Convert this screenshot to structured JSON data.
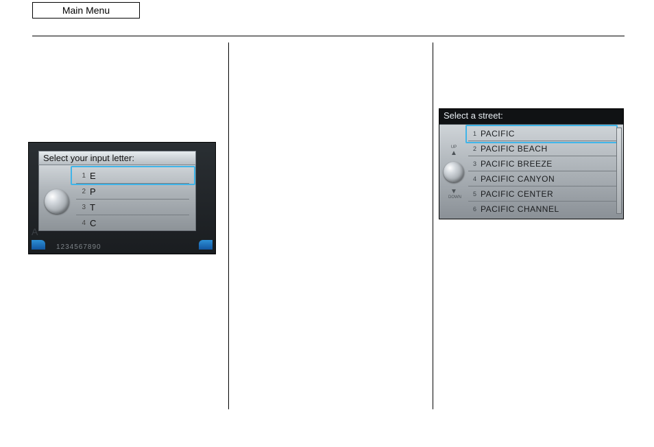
{
  "header": {
    "tab_label": "Main Menu"
  },
  "left_screen": {
    "title": "Select your input letter:",
    "letters": [
      "E",
      "P",
      "T",
      "C"
    ],
    "numstrip": "1234567890",
    "shadedA": "A"
  },
  "right_screen": {
    "title": "Select a street:",
    "streets": [
      "PACIFIC",
      "PACIFIC BEACH",
      "PACIFIC BREEZE",
      "PACIFIC CANYON",
      "PACIFIC CENTER",
      "PACIFIC CHANNEL"
    ],
    "up_label": "UP",
    "down_label": "DOWN"
  }
}
